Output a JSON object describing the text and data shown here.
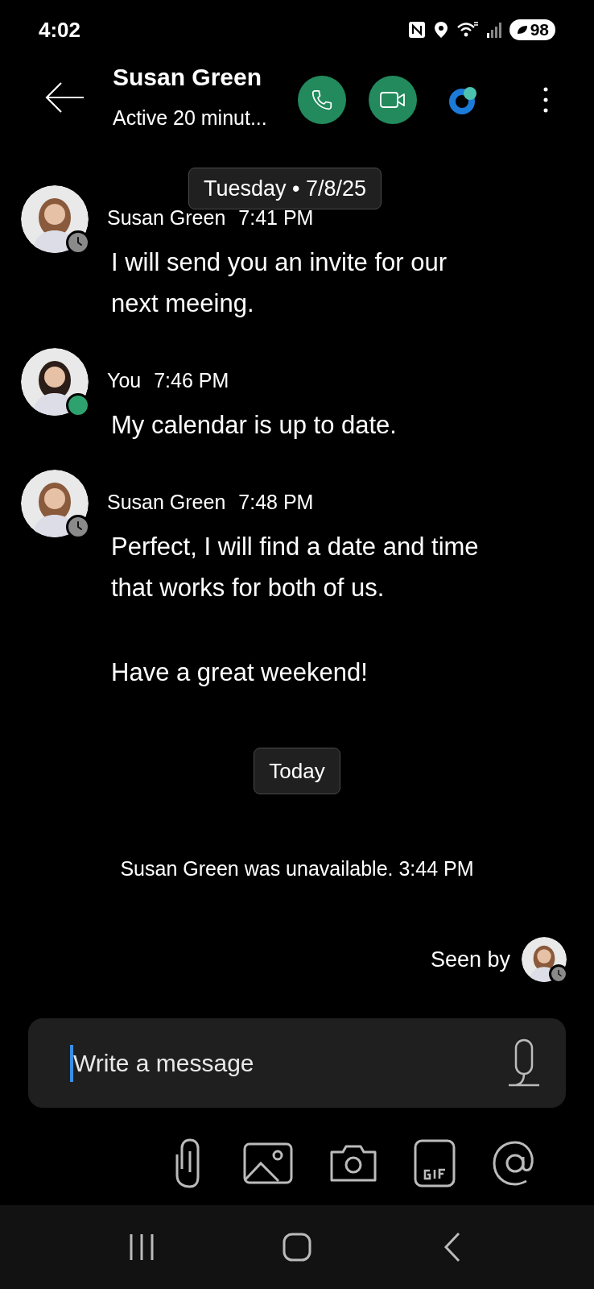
{
  "status_bar": {
    "time": "4:02",
    "battery": "98"
  },
  "header": {
    "name": "Susan Green",
    "status": "Active 20 minut..."
  },
  "date_chip": "Tuesday • 7/8/25",
  "messages": [
    {
      "sender": "Susan Green",
      "time": "7:41 PM",
      "away": true,
      "paragraphs": [
        "I will send you an invite for our next meeing."
      ]
    },
    {
      "sender": "You",
      "time": "7:46 PM",
      "away": false,
      "paragraphs": [
        "My calendar is up to date."
      ]
    },
    {
      "sender": "Susan Green",
      "time": "7:48 PM",
      "away": true,
      "paragraphs": [
        "Perfect, I will find a date and time that works for both of us.",
        "Have a great weekend!"
      ]
    }
  ],
  "today_chip": "Today",
  "event": "Susan Green was unavailable. 3:44 PM",
  "seen_by": {
    "label": "Seen by",
    "away": true
  },
  "composer": {
    "placeholder": "Write a message"
  }
}
